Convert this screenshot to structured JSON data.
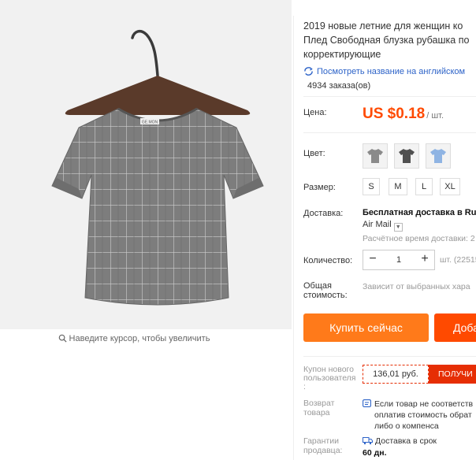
{
  "product": {
    "title_lines": [
      "2019 новые летние для женщин ко",
      "Плед Свободная блузка рубашка по",
      "корректирующие"
    ],
    "translate_link": "Посмотреть название на английском",
    "orders": "4934 заказа(ов)"
  },
  "gallery": {
    "zoom_hint": "Наведите курсор, чтобы увеличить",
    "tag_text": "GE.MON"
  },
  "price": {
    "label": "Цена:",
    "amount": "US $0.18",
    "unit": "/ шт."
  },
  "color": {
    "label": "Цвет:",
    "swatches": [
      {
        "name": "gray",
        "color": "#8a8a8a"
      },
      {
        "name": "dark-gray",
        "color": "#505050"
      },
      {
        "name": "light-blue",
        "color": "#8fb4e3"
      }
    ]
  },
  "size": {
    "label": "Размер:",
    "options": [
      "S",
      "M",
      "L",
      "XL"
    ]
  },
  "shipping": {
    "label": "Доставка:",
    "main": "Бесплатная доставка в Rus",
    "method": "Air Mail",
    "time": "Расчётное время доставки: 2"
  },
  "quantity": {
    "label": "Количество:",
    "minus": "−",
    "value": "1",
    "plus": "+",
    "stock": "шт. (22515"
  },
  "total": {
    "label_line1": "Общая",
    "label_line2": "стоимость:",
    "note": "Зависит от выбранных хара"
  },
  "buttons": {
    "buy_now": "Купить сейчас",
    "add_to_cart": "Доба"
  },
  "coupon": {
    "label_line1": "Купон нового",
    "label_line2": "пользователя",
    "label_line3": ":",
    "value": "136,01 руб.",
    "get": "ПОЛУЧИ"
  },
  "returns": {
    "label_line1": "Возврат",
    "label_line2": "товара",
    "line1": "Если товар не соответств",
    "line2": "оплатив стоимость обрат",
    "line3": "либо о компенса"
  },
  "guarantee": {
    "label_line1": "Гарантии",
    "label_line2": "продавца:",
    "line1": "Доставка в срок",
    "line2": "60 дн."
  },
  "colors": {
    "accent_orange": "#ff7a1a",
    "price_red": "#ff4a00",
    "coupon_red": "#e62e04",
    "link_blue": "#2d63c8"
  }
}
